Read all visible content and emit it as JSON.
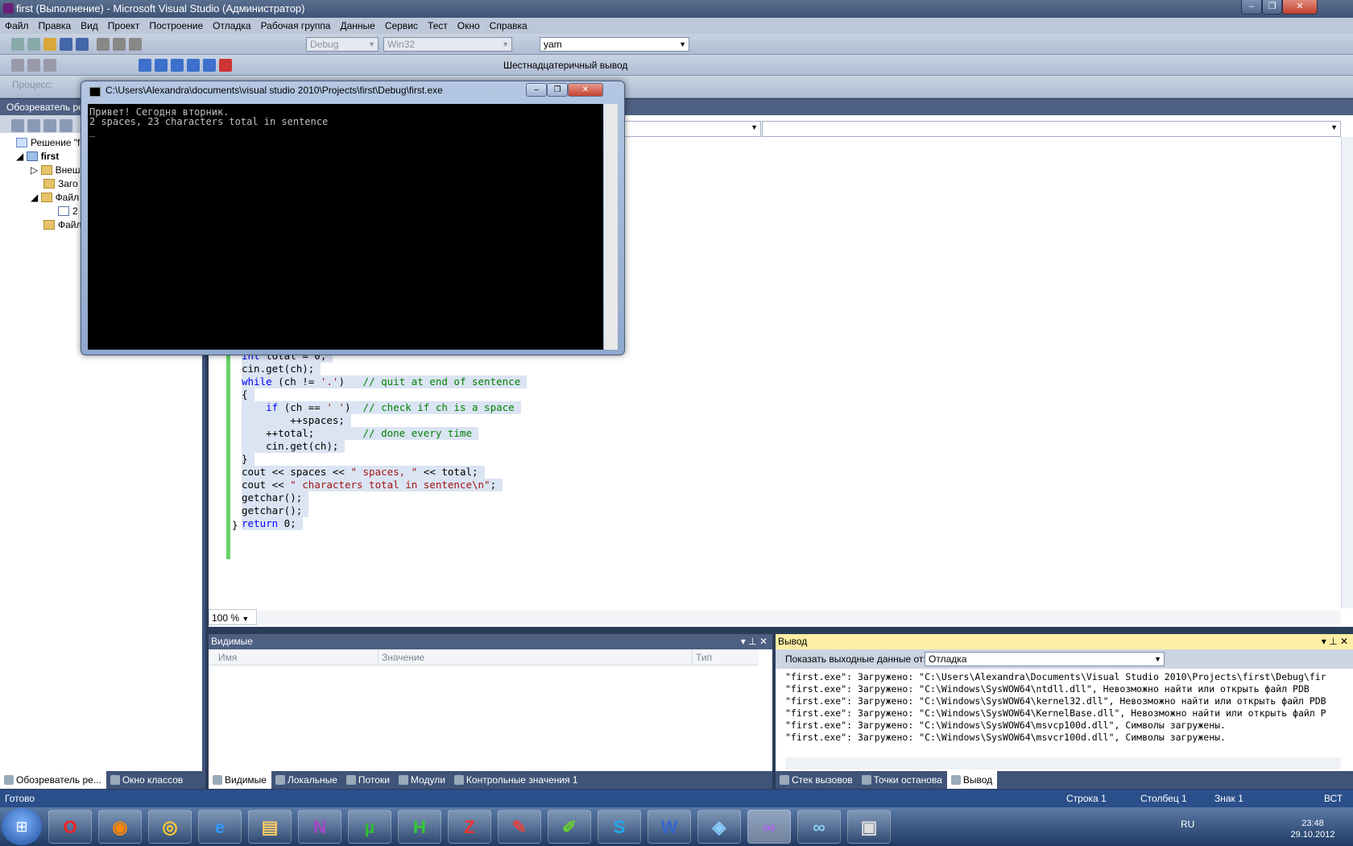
{
  "window": {
    "title": "first (Выполнение) - Microsoft Visual Studio (Администратор)"
  },
  "menu": [
    "Файл",
    "Правка",
    "Вид",
    "Проект",
    "Построение",
    "Отладка",
    "Рабочая группа",
    "Данные",
    "Сервис",
    "Тест",
    "Окно",
    "Справка"
  ],
  "toolbar": {
    "config": "Debug",
    "platform": "Win32",
    "find": "yam",
    "hex_label": "Шестнадцатеричный вывод",
    "process_label": "Процесс:"
  },
  "solution": {
    "header": "Обозреватель ре",
    "items": [
      "Решение \"f",
      "first",
      "Внеш",
      "Заго",
      "Файл",
      "2",
      "Файл"
    ]
  },
  "code": [
    {
      "parts": [
        {
          "t": "int",
          "c": "kw"
        },
        {
          "t": " total = 0;"
        }
      ]
    },
    {
      "parts": [
        {
          "t": "cin.get(ch);"
        }
      ]
    },
    {
      "parts": [
        {
          "t": "while",
          "c": "kw"
        },
        {
          "t": " (ch != "
        },
        {
          "t": "'.'",
          "c": "st"
        },
        {
          "t": ")   "
        },
        {
          "t": "// quit at end of sentence",
          "c": "cm"
        }
      ]
    },
    {
      "parts": [
        {
          "t": "{"
        }
      ]
    },
    {
      "parts": [
        {
          "t": "    "
        },
        {
          "t": "if",
          "c": "kw"
        },
        {
          "t": " (ch == "
        },
        {
          "t": "' '",
          "c": "st"
        },
        {
          "t": ")  "
        },
        {
          "t": "// check if ch is a space",
          "c": "cm"
        }
      ]
    },
    {
      "parts": [
        {
          "t": "        ++spaces;"
        }
      ]
    },
    {
      "parts": [
        {
          "t": "    ++total;        "
        },
        {
          "t": "// done every time",
          "c": "cm"
        }
      ]
    },
    {
      "parts": [
        {
          "t": "    cin.get(ch);"
        }
      ]
    },
    {
      "parts": [
        {
          "t": "}"
        }
      ]
    },
    {
      "parts": [
        {
          "t": "cout << spaces << "
        },
        {
          "t": "\" spaces, \"",
          "c": "st"
        },
        {
          "t": " << total;"
        }
      ]
    },
    {
      "parts": [
        {
          "t": "cout << "
        },
        {
          "t": "\" characters total in sentence\\n\"",
          "c": "st"
        },
        {
          "t": ";"
        }
      ]
    },
    {
      "parts": [
        {
          "t": "getchar();"
        }
      ]
    },
    {
      "parts": [
        {
          "t": "getchar();"
        }
      ]
    },
    {
      "parts": [
        {
          "t": "return",
          "c": "kw"
        },
        {
          "t": " 0;"
        }
      ]
    }
  ],
  "closing_brace": "}",
  "zoom": "100 %",
  "console": {
    "title": "C:\\Users\\Alexandra\\documents\\visual studio 2010\\Projects\\first\\Debug\\first.exe",
    "lines": "Привет! Сегодня вторник.\n2 spaces, 23 characters total in sentence\n_"
  },
  "watch": {
    "title": "Видимые",
    "cols": [
      "Имя",
      "Значение",
      "Тип"
    ]
  },
  "output": {
    "title": "Вывод",
    "show_label": "Показать выходные данные от:",
    "source": "Отладка",
    "lines": "\"first.exe\": Загружено: \"C:\\Users\\Alexandra\\Documents\\Visual Studio 2010\\Projects\\first\\Debug\\fir\n\"first.exe\": Загружено: \"C:\\Windows\\SysWOW64\\ntdll.dll\", Невозможно найти или открыть файл PDB\n\"first.exe\": Загружено: \"C:\\Windows\\SysWOW64\\kernel32.dll\", Невозможно найти или открыть файл PDB\n\"first.exe\": Загружено: \"C:\\Windows\\SysWOW64\\KernelBase.dll\", Невозможно найти или открыть файл P\n\"first.exe\": Загружено: \"C:\\Windows\\SysWOW64\\msvcp100d.dll\", Символы загружены.\n\"first.exe\": Загружено: \"C:\\Windows\\SysWOW64\\msvcr100d.dll\", Символы загружены."
  },
  "tabs_left": [
    "Обозреватель ре...",
    "Окно классов"
  ],
  "tabs_mid": [
    "Видимые",
    "Локальные",
    "Потоки",
    "Модули",
    "Контрольные значения 1"
  ],
  "tabs_right": [
    "Стек вызовов",
    "Точки останова",
    "Вывод"
  ],
  "status": {
    "ready": "Готово",
    "line": "Строка 1",
    "col": "Столбец 1",
    "char": "Знак 1",
    "ins": "ВСТ"
  },
  "taskbar": {
    "lang": "RU",
    "time": "23:48",
    "date": "29.10.2012"
  }
}
